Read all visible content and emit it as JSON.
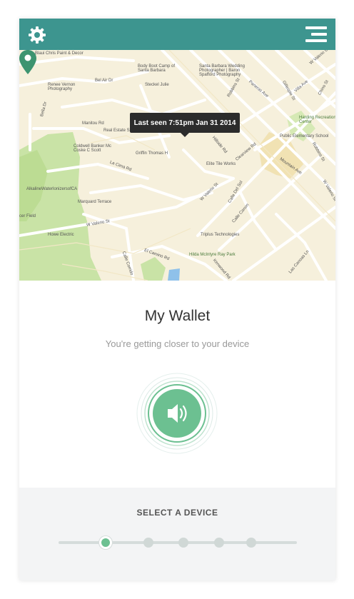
{
  "header": {
    "settings_icon": "gear-icon",
    "menu_icon": "hamburger-menu-icon",
    "color": "#3d958f"
  },
  "map": {
    "tooltip": "Last seen 7:51pm Jan 31 2014",
    "pin_icon": "map-pin-icon",
    "pin_color": "#3d9470",
    "labels": {
      "blaui": "Blaui Chris Paint & Decor",
      "body_boot": "Body Boot Camp of Santa Barbara",
      "wedding": "Santa Barbara Wedding Photographer | Baron Spafford Photography",
      "renee": "Renee Vernon Photography",
      "bel_air": "Bel Air Dr",
      "steckel": "Steckel Julie",
      "robbins_top": "Robbins St",
      "paneras": "Paneras Ave",
      "gillespie": "Gillespie St",
      "villa": "Villa Ave",
      "chino": "Chino St",
      "w_valerio_top": "W Valerio St",
      "harding": "Harding Recreation Center",
      "public_school": "Public Elementary School",
      "bella_dr": "Bella Dr",
      "manitou": "Manitou Rd",
      "real_estate": "Real Estate S",
      "coldwell": "Coldwell Banker Mc Coske C Scott",
      "griffin": "Griffin Thomas H",
      "hillside": "Hillside Rd",
      "clearview": "Clearview Rd",
      "elite_tile": "Elite Tile Works",
      "robbins_right": "Robbins St",
      "mountain": "Mountain Ave",
      "la_cima": "La Cima Rd",
      "w_valerio_mid": "W Valerio St",
      "calle_del_sol": "Calle Del Sol",
      "calle_canon": "Calle Canon",
      "alkaline": "AlkalineWaterIonizersofCA",
      "cer_field": "cer Field",
      "marquard": "Marquard Terrace",
      "w_valerio_low": "W Valerio St",
      "howe": "Howe Electric",
      "triplus": "Triplus Technologies",
      "el_camino": "El Camino Rd",
      "calle_corrido": "Calle Corrido",
      "hilda": "Hilda McIntyre Ray Park",
      "kenwood": "Kenwood Rd",
      "las_canoas": "Las Canoas Ln",
      "w_valerio_right": "W Valerio St"
    }
  },
  "device": {
    "name": "My Wallet",
    "status": "You're getting closer to your device",
    "sound_icon": "speaker-icon",
    "accent": "#6cc091"
  },
  "selector": {
    "label": "SELECT A DEVICE",
    "count": 5,
    "active_index": 0
  }
}
